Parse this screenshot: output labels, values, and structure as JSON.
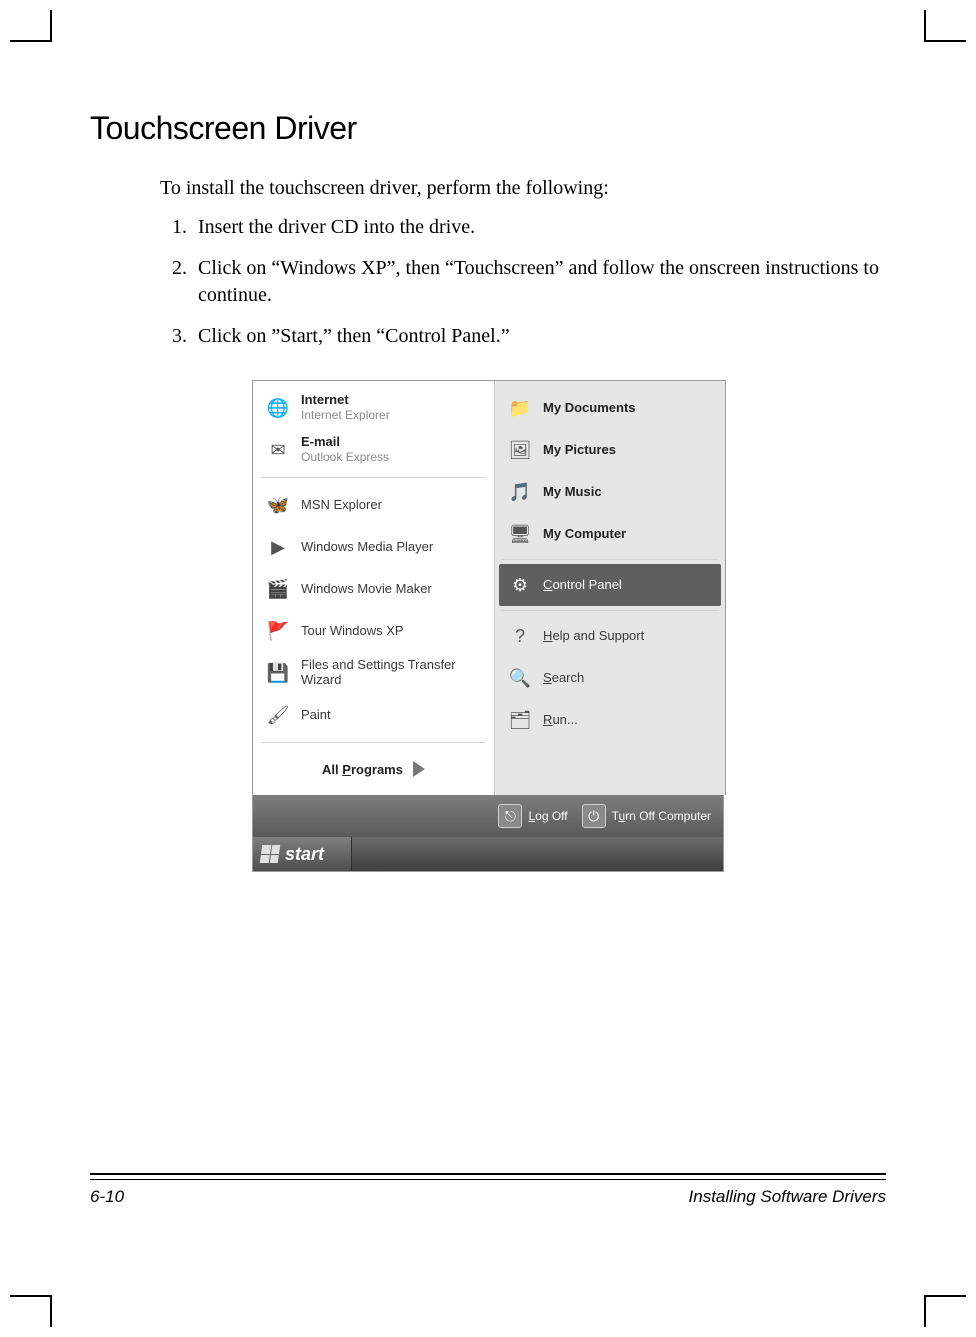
{
  "heading": "Touchscreen Driver",
  "lead": "To install the touchscreen driver, perform the following:",
  "steps": [
    "Insert the driver CD into the drive.",
    "Click on “Windows XP”, then “Touchscreen” and follow the onscreen instructions to continue.",
    "Click on ”Start,” then “Control Panel.”"
  ],
  "startmenu": {
    "left_pinned": [
      {
        "title": "Internet",
        "sub": "Internet Explorer",
        "icon": "🌐"
      },
      {
        "title": "E-mail",
        "sub": "Outlook Express",
        "icon": "✉"
      }
    ],
    "left_items": [
      {
        "label": "MSN Explorer",
        "icon": "🦋"
      },
      {
        "label": "Windows Media Player",
        "icon": "▶"
      },
      {
        "label": "Windows Movie Maker",
        "icon": "🎬"
      },
      {
        "label": "Tour Windows XP",
        "icon": "🚩"
      },
      {
        "label": "Files and Settings Transfer Wizard",
        "icon": "💾"
      },
      {
        "label": "Paint",
        "icon": "🖌"
      }
    ],
    "all_programs": "All Programs",
    "right_top": [
      {
        "label": "My Documents",
        "bold": true,
        "icon": "📁"
      },
      {
        "label": "My Pictures",
        "bold": true,
        "icon": "🖼"
      },
      {
        "label": "My Music",
        "bold": true,
        "icon": "🎵"
      },
      {
        "label": "My Computer",
        "bold": true,
        "icon": "🖥"
      }
    ],
    "right_mid": [
      {
        "label": "Control Panel",
        "icon": "⚙",
        "selected": true,
        "ul": 0
      }
    ],
    "right_bottom": [
      {
        "label": "Help and Support",
        "icon": "?",
        "ul": 0
      },
      {
        "label": "Search",
        "icon": "🔍",
        "ul": 0
      },
      {
        "label": "Run...",
        "icon": "🗂",
        "ul": 0
      }
    ],
    "logoff": "Log Off",
    "turnoff": "Turn Off Computer",
    "start": "start"
  },
  "footer": {
    "left": "6-10",
    "right": "Installing Software Drivers"
  }
}
